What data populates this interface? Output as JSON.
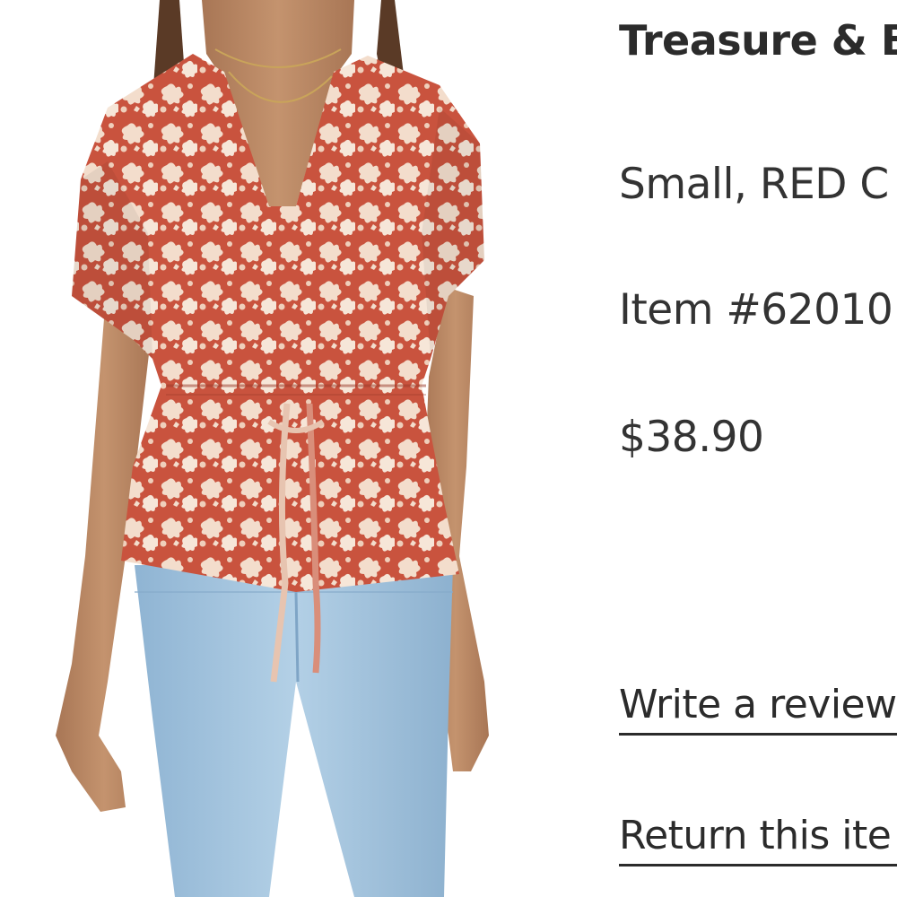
{
  "product": {
    "image_alt": "Woman wearing a red floral print short-sleeve blouse with tie waist and light-wash jeans",
    "brand": "Treasure & B",
    "variant": "Small, RED C",
    "item_number": "Item #62010",
    "price": "$38.90"
  },
  "actions": {
    "write_review": "Write a review",
    "return_item": "Return this ite"
  },
  "colors": {
    "blouse_red": "#c9533e",
    "blouse_flower": "#f3ddcc",
    "denim": "#9dc0dc",
    "skin": "#b88662",
    "link_underline": "#2b2b2b"
  }
}
